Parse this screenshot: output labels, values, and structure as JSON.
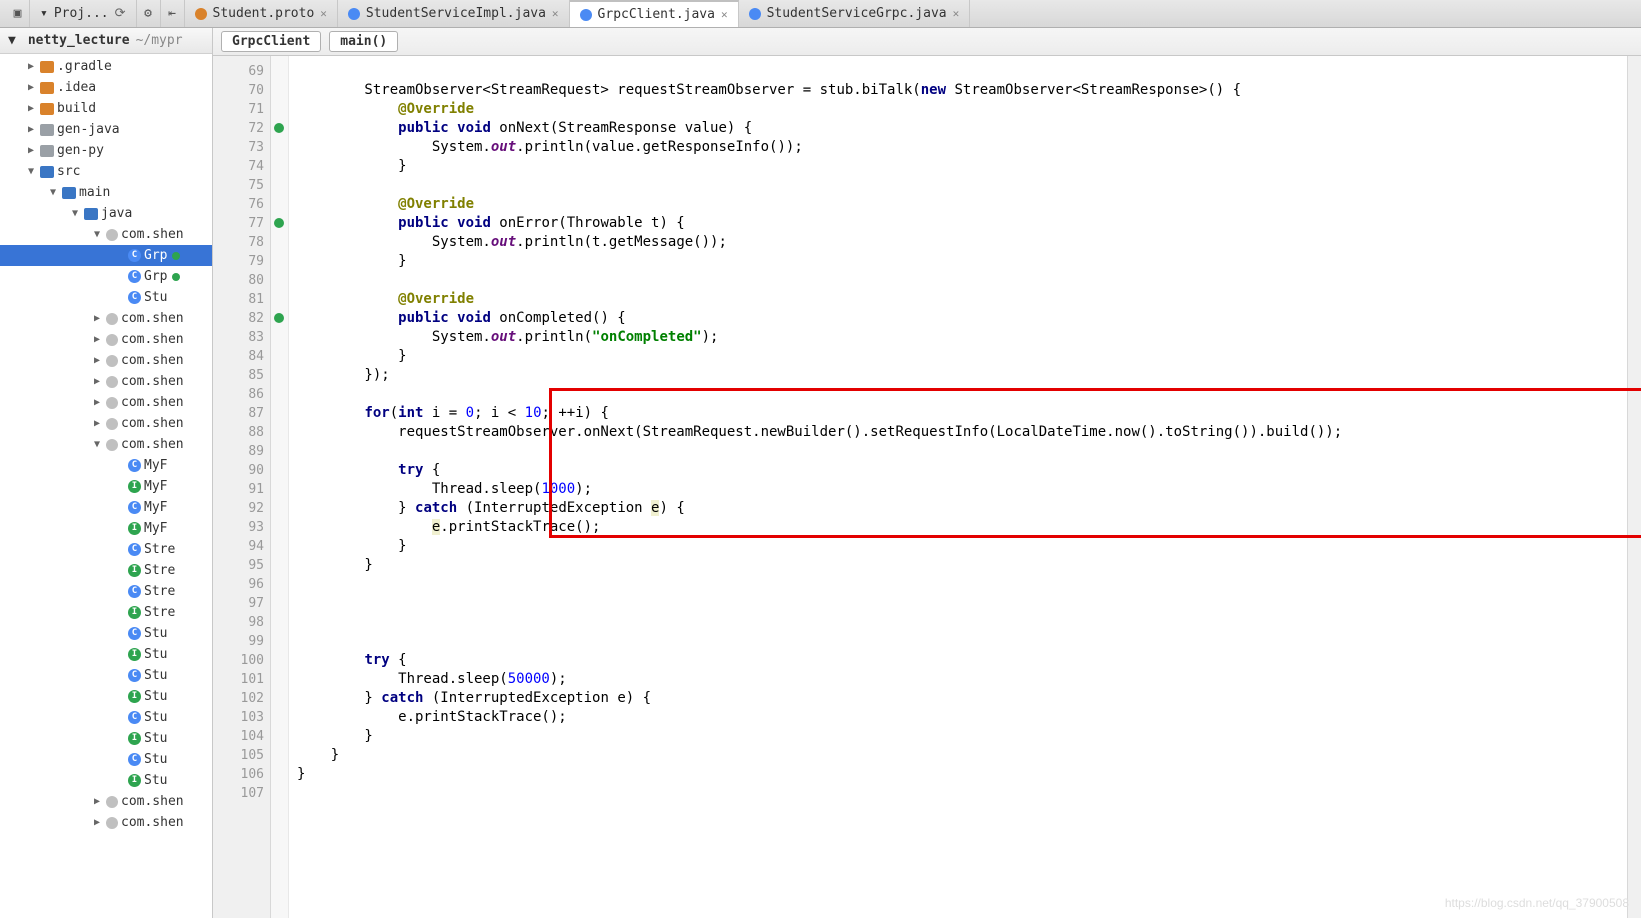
{
  "toolbarLeft": {
    "proj_label": "Proj..."
  },
  "tabs": [
    {
      "label": "Student.proto",
      "icon_color": "#d9822b",
      "active": false
    },
    {
      "label": "StudentServiceImpl.java",
      "icon_color": "#4a8af4",
      "active": false
    },
    {
      "label": "GrpcClient.java",
      "icon_color": "#4a8af4",
      "active": true
    },
    {
      "label": "StudentServiceGrpc.java",
      "icon_color": "#4a8af4",
      "active": false
    }
  ],
  "crumbs": {
    "class": "GrpcClient",
    "method": "main()"
  },
  "project": {
    "root": "netty_lecture",
    "root_path": "~/mypr",
    "nodes": [
      {
        "indent": 18,
        "arrow": "▶",
        "ftype": "orange",
        "label": ".gradle"
      },
      {
        "indent": 18,
        "arrow": "▶",
        "ftype": "orange",
        "label": ".idea"
      },
      {
        "indent": 18,
        "arrow": "▶",
        "ftype": "orange",
        "label": "build"
      },
      {
        "indent": 18,
        "arrow": "▶",
        "ftype": "gray",
        "label": "gen-java"
      },
      {
        "indent": 18,
        "arrow": "▶",
        "ftype": "gray",
        "label": "gen-py"
      },
      {
        "indent": 18,
        "arrow": "▼",
        "ftype": "blue",
        "label": "src"
      },
      {
        "indent": 40,
        "arrow": "▼",
        "ftype": "blue",
        "label": "main"
      },
      {
        "indent": 62,
        "arrow": "▼",
        "ftype": "blue",
        "label": "java"
      },
      {
        "indent": 84,
        "arrow": "▼",
        "ftype": "pkg",
        "label": "com.shen"
      },
      {
        "indent": 106,
        "arrow": "",
        "ftype": "file-c",
        "label": "Grp",
        "sel": true,
        "vcs": true
      },
      {
        "indent": 106,
        "arrow": "",
        "ftype": "file-c",
        "label": "Grp",
        "vcs": true
      },
      {
        "indent": 106,
        "arrow": "",
        "ftype": "file-c",
        "label": "Stu"
      },
      {
        "indent": 84,
        "arrow": "▶",
        "ftype": "pkg",
        "label": "com.shen"
      },
      {
        "indent": 84,
        "arrow": "▶",
        "ftype": "pkg",
        "label": "com.shen"
      },
      {
        "indent": 84,
        "arrow": "▶",
        "ftype": "pkg",
        "label": "com.shen"
      },
      {
        "indent": 84,
        "arrow": "▶",
        "ftype": "pkg",
        "label": "com.shen"
      },
      {
        "indent": 84,
        "arrow": "▶",
        "ftype": "pkg",
        "label": "com.shen"
      },
      {
        "indent": 84,
        "arrow": "▶",
        "ftype": "pkg",
        "label": "com.shen"
      },
      {
        "indent": 84,
        "arrow": "▼",
        "ftype": "pkg",
        "label": "com.shen"
      },
      {
        "indent": 106,
        "arrow": "",
        "ftype": "file-c",
        "label": "MyF"
      },
      {
        "indent": 106,
        "arrow": "",
        "ftype": "file-i",
        "label": "MyF"
      },
      {
        "indent": 106,
        "arrow": "",
        "ftype": "file-c",
        "label": "MyF"
      },
      {
        "indent": 106,
        "arrow": "",
        "ftype": "file-i",
        "label": "MyF"
      },
      {
        "indent": 106,
        "arrow": "",
        "ftype": "file-c",
        "label": "Stre"
      },
      {
        "indent": 106,
        "arrow": "",
        "ftype": "file-i",
        "label": "Stre"
      },
      {
        "indent": 106,
        "arrow": "",
        "ftype": "file-c",
        "label": "Stre"
      },
      {
        "indent": 106,
        "arrow": "",
        "ftype": "file-i",
        "label": "Stre"
      },
      {
        "indent": 106,
        "arrow": "",
        "ftype": "file-c",
        "label": "Stu"
      },
      {
        "indent": 106,
        "arrow": "",
        "ftype": "file-i",
        "label": "Stu"
      },
      {
        "indent": 106,
        "arrow": "",
        "ftype": "file-c",
        "label": "Stu"
      },
      {
        "indent": 106,
        "arrow": "",
        "ftype": "file-i",
        "label": "Stu"
      },
      {
        "indent": 106,
        "arrow": "",
        "ftype": "file-c",
        "label": "Stu"
      },
      {
        "indent": 106,
        "arrow": "",
        "ftype": "file-i",
        "label": "Stu"
      },
      {
        "indent": 106,
        "arrow": "",
        "ftype": "file-c",
        "label": "Stu"
      },
      {
        "indent": 106,
        "arrow": "",
        "ftype": "file-i",
        "label": "Stu"
      },
      {
        "indent": 84,
        "arrow": "▶",
        "ftype": "pkg",
        "label": "com.shen"
      },
      {
        "indent": 84,
        "arrow": "▶",
        "ftype": "pkg",
        "label": "com.shen"
      }
    ]
  },
  "lines": {
    "start": 69,
    "end": 107,
    "marks": [
      72,
      77,
      82
    ],
    "highlight": 96
  },
  "code": {
    "l69": "        StreamObserver<StreamRequest> requestStreamObserver = stub.biTalk(",
    "l69_kw": "new",
    "l69_b": " StreamObserver<StreamResponse>() {",
    "l70": "            @Override",
    "l71a": "            ",
    "l71_kw": "public void",
    "l71b": " onNext(StreamResponse value) {",
    "l72": "                System.",
    "l72_fld": "out",
    "l72b": ".println(value.getResponseInfo());",
    "l73": "            }",
    "l74": "",
    "l75": "            @Override",
    "l76a": "            ",
    "l76_kw": "public void",
    "l76b": " onError(Throwable t) {",
    "l77": "                System.",
    "l77_fld": "out",
    "l77b": ".println(t.getMessage());",
    "l78": "            }",
    "l79": "",
    "l80": "            @Override",
    "l81a": "            ",
    "l81_kw": "public void",
    "l81b": " onCompleted() {",
    "l82": "                System.",
    "l82_fld": "out",
    "l82b": ".println(",
    "l82_str": "\"onCompleted\"",
    "l82c": ");",
    "l83": "            }",
    "l84": "        });",
    "l85": "",
    "l86a": "        ",
    "l86_kw": "for",
    "l86b": "(",
    "l86_kw2": "int",
    "l86c": " i = ",
    "l86_n0": "0",
    "l86d": "; i < ",
    "l86_n1": "10",
    "l86e": "; ++i) {",
    "l87": "            requestStreamObserver.onNext(StreamRequest.newBuilder().setRequestInfo(LocalDateTime.now().toString()).build());",
    "l88": "",
    "l89a": "            ",
    "l89_kw": "try",
    "l89b": " {",
    "l90a": "                Thread.sleep(",
    "l90_n": "1000",
    "l90b": ");",
    "l91a": "            } ",
    "l91_kw": "catch",
    "l91b": " (InterruptedException ",
    "l91_warn": "e",
    "l91c": ") {",
    "l92a": "                ",
    "l92_warn": "e",
    "l92b": ".printStackTrace();",
    "l93": "            }",
    "l94": "        }",
    "l95": "",
    "l96": "",
    "l97": "",
    "l98": "",
    "l99a": "        ",
    "l99_kw": "try",
    "l99b": " {",
    "l100a": "            Thread.sleep(",
    "l100_n": "50000",
    "l100b": ");",
    "l101a": "        } ",
    "l101_kw": "catch",
    "l101b": " (InterruptedException e) {",
    "l102": "            e.printStackTrace();",
    "l103": "        }",
    "l104": "    }",
    "l105": "}"
  },
  "watermark": "https://blog.csdn.net/qq_37900508"
}
